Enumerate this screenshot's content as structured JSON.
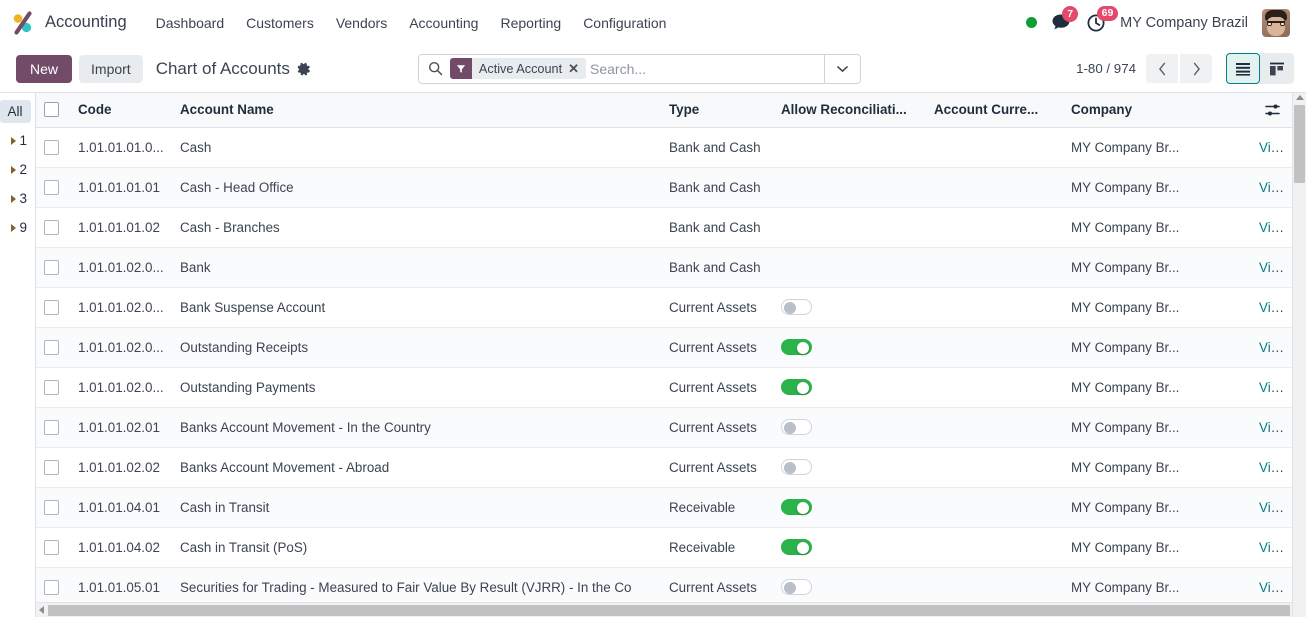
{
  "navbar": {
    "brand": "Accounting",
    "logo_icon": "odoo-logo-icon",
    "menu_items": [
      {
        "label": "Dashboard"
      },
      {
        "label": "Customers"
      },
      {
        "label": "Vendors"
      },
      {
        "label": "Accounting"
      },
      {
        "label": "Reporting"
      },
      {
        "label": "Configuration"
      }
    ],
    "status_dot_color": "#0f9d36",
    "messages_icon": "chat-bubble-icon",
    "messages_count": "7",
    "activities_icon": "clock-icon",
    "activities_count": "69",
    "company": "MY Company Brazil",
    "avatar_icon": "user-avatar"
  },
  "control_panel": {
    "new_label": "New",
    "import_label": "Import",
    "title": "Chart of Accounts",
    "gear_icon": "gear-icon",
    "search": {
      "search_icon": "search-icon",
      "facet_icon": "filter-funnel-icon",
      "facet_label": "Active Account",
      "facet_remove_icon": "close-icon",
      "placeholder": "Search...",
      "value": "",
      "toggle_icon": "chevron-down-icon"
    },
    "pager": {
      "range": "1-80 / 974",
      "prev_icon": "chevron-left-icon",
      "next_icon": "chevron-right-icon"
    },
    "view_switcher": {
      "list_icon": "list-view-icon",
      "kanban_icon": "kanban-view-icon",
      "active": "list",
      "active_color": "#017e84"
    }
  },
  "sidebar": {
    "items": [
      {
        "label": "All",
        "selected": true,
        "expandable": false
      },
      {
        "label": "1",
        "selected": false,
        "expandable": true
      },
      {
        "label": "2",
        "selected": false,
        "expandable": true
      },
      {
        "label": "3",
        "selected": false,
        "expandable": true
      },
      {
        "label": "9",
        "selected": false,
        "expandable": true
      }
    ]
  },
  "table": {
    "optional_columns_icon": "column-settings-icon",
    "columns": [
      {
        "key": "code",
        "label": "Code"
      },
      {
        "key": "name",
        "label": "Account Name"
      },
      {
        "key": "type",
        "label": "Type"
      },
      {
        "key": "reconciliation",
        "label": "Allow Reconciliati..."
      },
      {
        "key": "currency",
        "label": "Account Curre..."
      },
      {
        "key": "company",
        "label": "Company"
      }
    ],
    "view_label": "View",
    "rows": [
      {
        "code": "1.01.01.01.0...",
        "name": "Cash",
        "type": "Bank and Cash",
        "reconcile": null,
        "currency": "",
        "company": "MY Company Br...",
        "view": "View"
      },
      {
        "code": "1.01.01.01.01",
        "name": "Cash - Head Office",
        "type": "Bank and Cash",
        "reconcile": null,
        "currency": "",
        "company": "MY Company Br...",
        "view": "View"
      },
      {
        "code": "1.01.01.01.02",
        "name": "Cash - Branches",
        "type": "Bank and Cash",
        "reconcile": null,
        "currency": "",
        "company": "MY Company Br...",
        "view": "View"
      },
      {
        "code": "1.01.01.02.0...",
        "name": "Bank",
        "type": "Bank and Cash",
        "reconcile": null,
        "currency": "",
        "company": "MY Company Br...",
        "view": "View"
      },
      {
        "code": "1.01.01.02.0...",
        "name": "Bank Suspense Account",
        "type": "Current Assets",
        "reconcile": false,
        "currency": "",
        "company": "MY Company Br...",
        "view": "View"
      },
      {
        "code": "1.01.01.02.0...",
        "name": "Outstanding Receipts",
        "type": "Current Assets",
        "reconcile": true,
        "currency": "",
        "company": "MY Company Br...",
        "view": "View"
      },
      {
        "code": "1.01.01.02.0...",
        "name": "Outstanding Payments",
        "type": "Current Assets",
        "reconcile": true,
        "currency": "",
        "company": "MY Company Br...",
        "view": "View"
      },
      {
        "code": "1.01.01.02.01",
        "name": "Banks Account Movement - In the Country",
        "type": "Current Assets",
        "reconcile": false,
        "currency": "",
        "company": "MY Company Br...",
        "view": "View"
      },
      {
        "code": "1.01.01.02.02",
        "name": "Banks Account Movement - Abroad",
        "type": "Current Assets",
        "reconcile": false,
        "currency": "",
        "company": "MY Company Br...",
        "view": "View"
      },
      {
        "code": "1.01.01.04.01",
        "name": "Cash in Transit",
        "type": "Receivable",
        "reconcile": true,
        "currency": "",
        "company": "MY Company Br...",
        "view": "View"
      },
      {
        "code": "1.01.01.04.02",
        "name": "Cash in Transit (PoS)",
        "type": "Receivable",
        "reconcile": true,
        "currency": "",
        "company": "MY Company Br...",
        "view": "View"
      },
      {
        "code": "1.01.01.05.01",
        "name": "Securities for Trading - Measured to Fair Value By Result (VJRR) - In the Co",
        "type": "Current Assets",
        "reconcile": false,
        "currency": "",
        "company": "MY Company Br...",
        "view": "View"
      }
    ]
  }
}
